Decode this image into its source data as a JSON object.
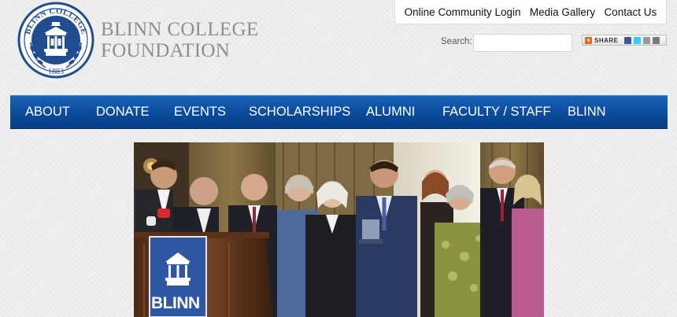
{
  "header": {
    "logo": {
      "ring_text": "BLINN COLLEGE",
      "year": "1883",
      "color": "#1f4d8f"
    },
    "org_name_line1": "BLINN COLLEGE",
    "org_name_line2": "FOUNDATION",
    "utility_links": [
      "Online Community Login",
      "Media Gallery",
      "Contact Us"
    ],
    "search": {
      "label": "Search:",
      "value": "",
      "placeholder": ""
    },
    "share": {
      "label": "SHARE",
      "icons": [
        "facebook-icon",
        "twitter-icon",
        "email-icon",
        "more-icon"
      ]
    }
  },
  "nav": {
    "items": [
      "ABOUT",
      "DONATE",
      "EVENTS",
      "SCHOLARSHIPS",
      "ALUMNI",
      "FACULTY / STAFF",
      "BLINN"
    ],
    "colors": {
      "bar": "#0a4a9a",
      "text": "#ffffff"
    }
  },
  "hero": {
    "podium_text": "BLINN"
  }
}
